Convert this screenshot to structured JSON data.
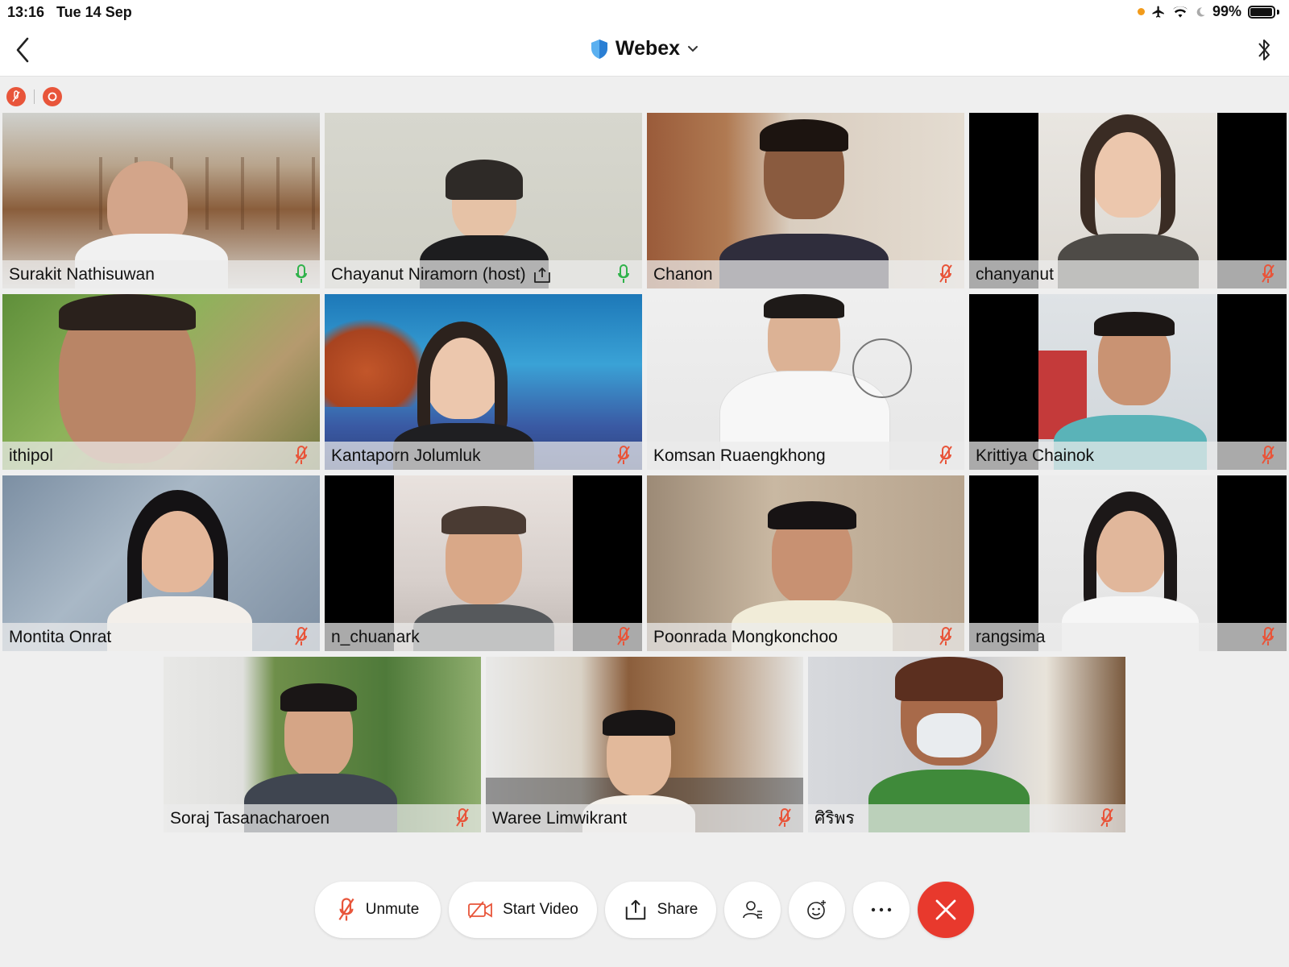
{
  "status_bar": {
    "time": "13:16",
    "date": "Tue 14 Sep",
    "battery": "99%",
    "icons": [
      "location-dot-icon",
      "airplane-icon",
      "wifi-icon",
      "moon-icon",
      "battery-icon"
    ]
  },
  "title_bar": {
    "app_title": "Webex",
    "icons": [
      "back-chevron-icon",
      "shield-icon",
      "chevron-down-icon",
      "bluetooth-icon"
    ]
  },
  "indicators": [
    "muted-icon",
    "recording-icon"
  ],
  "participants": [
    {
      "name": "Surakit Nathisuwan",
      "mic": "active"
    },
    {
      "name": "Chayanut Niramorn (host)",
      "mic": "active",
      "sharing": true
    },
    {
      "name": "Chanon",
      "mic": "muted"
    },
    {
      "name": "chanyanut",
      "mic": "muted"
    },
    {
      "name": "ithipol",
      "mic": "muted"
    },
    {
      "name": "Kantaporn Jolumluk",
      "mic": "muted"
    },
    {
      "name": "Komsan Ruaengkhong",
      "mic": "muted"
    },
    {
      "name": "Krittiya Chainok",
      "mic": "muted"
    },
    {
      "name": "Montita Onrat",
      "mic": "muted"
    },
    {
      "name": "n_chuanark",
      "mic": "muted"
    },
    {
      "name": "Poonrada Mongkonchoo",
      "mic": "muted"
    },
    {
      "name": "rangsima",
      "mic": "muted"
    },
    {
      "name": "Soraj Tasanacharoen",
      "mic": "muted"
    },
    {
      "name": "Waree Limwikrant",
      "mic": "muted"
    },
    {
      "name": "ศิริพร",
      "mic": "muted"
    }
  ],
  "toolbar": {
    "unmute_label": "Unmute",
    "start_video_label": "Start Video",
    "share_label": "Share",
    "icons": [
      "participants-icon",
      "reactions-icon",
      "more-icon",
      "end-call-icon"
    ]
  },
  "colors": {
    "accent_red": "#e8392d",
    "mic_active_green": "#2fb24a",
    "mic_muted_red": "#e8553a",
    "background": "#efefef"
  }
}
